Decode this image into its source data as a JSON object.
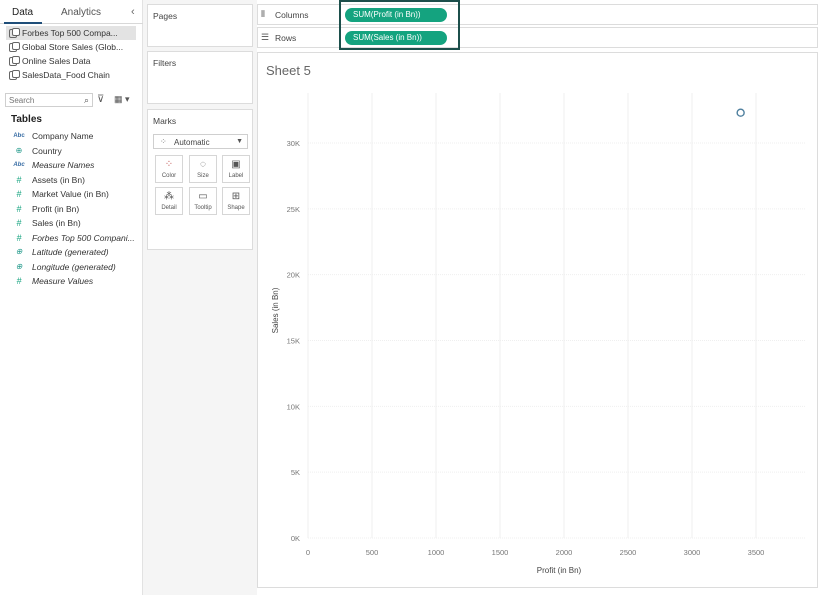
{
  "data_pane": {
    "tabs": {
      "data": "Data",
      "analytics": "Analytics"
    },
    "data_sources": [
      {
        "label": "Forbes Top 500 Compa...",
        "selected": true
      },
      {
        "label": "Global Store Sales (Glob...",
        "selected": false
      },
      {
        "label": "Online Sales Data",
        "selected": false
      },
      {
        "label": "SalesData_Food Chain",
        "selected": false
      }
    ],
    "search_placeholder": "Search",
    "tables_header": "Tables",
    "fields": [
      {
        "label": "Company Name",
        "type": "abc",
        "italic": false
      },
      {
        "label": "Country",
        "type": "globe",
        "italic": false
      },
      {
        "label": "Measure Names",
        "type": "abc",
        "italic": true
      },
      {
        "label": "Assets (in Bn)",
        "type": "hash",
        "italic": false
      },
      {
        "label": "Market Value (in Bn)",
        "type": "hash",
        "italic": false
      },
      {
        "label": "Profit (in Bn)",
        "type": "hash",
        "italic": false
      },
      {
        "label": "Sales (in Bn)",
        "type": "hash",
        "italic": false
      },
      {
        "label": "Forbes Top 500 Compani...",
        "type": "hash",
        "italic": true
      },
      {
        "label": "Latitude (generated)",
        "type": "globe",
        "italic": true
      },
      {
        "label": "Longitude (generated)",
        "type": "globe",
        "italic": true
      },
      {
        "label": "Measure Values",
        "type": "hash",
        "italic": true
      }
    ]
  },
  "cards": {
    "pages": "Pages",
    "filters": "Filters",
    "marks": "Marks",
    "mark_type": "Automatic",
    "mark_buttons": {
      "color": "Color",
      "size": "Size",
      "label": "Label",
      "detail": "Detail",
      "tooltip": "Tooltip",
      "shape": "Shape"
    }
  },
  "shelves": {
    "columns_label": "Columns",
    "rows_label": "Rows",
    "columns_pill": "SUM(Profit (in Bn))",
    "rows_pill": "SUM(Sales (in Bn))"
  },
  "sheet": {
    "title": "Sheet 5"
  },
  "chart_data": {
    "type": "scatter",
    "xlabel": "Profit (in Bn)",
    "ylabel": "Sales (in Bn)",
    "x_ticks": [
      0,
      500,
      1000,
      1500,
      2000,
      2500,
      3000,
      3500
    ],
    "y_ticks": [
      "0K",
      "5K",
      "10K",
      "15K",
      "20K",
      "25K",
      "30K"
    ],
    "y_tick_values": [
      0,
      5000,
      10000,
      15000,
      20000,
      25000,
      30000
    ],
    "xlim": [
      0,
      3500
    ],
    "ylim": [
      0,
      30000
    ],
    "points": [
      {
        "x": 3380,
        "y": 32300
      }
    ],
    "grid": true,
    "mark_color": "#4e7f9e"
  }
}
